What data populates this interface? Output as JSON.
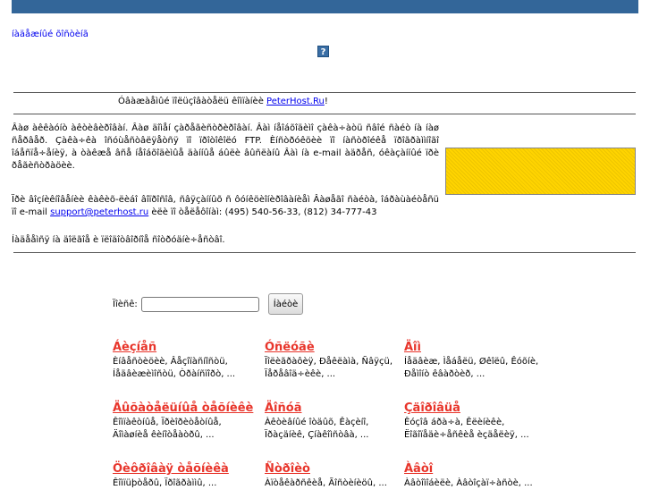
{
  "header": {
    "top_link": "íàäåæíûé õîñòèíã",
    "help_icon_label": "?"
  },
  "welcome": {
    "prefix": "Óâàæàåìûé ïîëüçîâàòåëü êîìïàíèè ",
    "link": "PeterHost.Ru",
    "suffix": "!"
  },
  "paragraphs": {
    "p1": "Âàø àêêàóíò àêòèâèðîâàí. Âàø äîìåí çàðåãèñòðèðîâàí. Âàì íåîáõîäèìî çàêà÷àòü ñâîé ñàéò íà íàø ñåðâåð. Çàêà÷êà îñóùåñòâëÿåòñÿ ïî ïðîòîêîëó FTP. Èíñòðóêöèè ïî íàñòðîéêå ïðîãðàììíîãî îáåñïå÷åíèÿ, à òàêæå âñå íåîáõîäèìûå äàííûå áûëè âûñëàíû Âàì íà e-mail àäðåñ, óêàçàííûé ïðè ðåãèñòðàöèè.",
    "p2_text": "Ïðè âîçíèêíîâåíèè êàêèõ-ëèáî âîïðîñîâ, ñâÿçàííûõ ñ ôóíêöèîíèðîâàíèåì Âàøåãî ñàéòà, îáðàùàéòåñü ïî e-mail ",
    "p2_email": "support@peterhost.ru",
    "p2_tail": " èëè ïî òåëåôîíàì: (495) 540-56-33, (812) 34-777-43",
    "p3": "Íàäååìñÿ íà äîëãîå è ïëîäîòâîðíîå ñîòðóäíè÷åñòâî."
  },
  "search": {
    "label": "Ïîèñê:",
    "value": "",
    "button": "Íàéòè"
  },
  "categories": [
    {
      "title": "Áèçíåñ",
      "sub": "Èíâåñòèöèè, Âåçîïàñíîñòü, Íåäâèæèìîñòü, Òðàíñïîðò, ..."
    },
    {
      "title": "Óñëóãè",
      "sub": "Ïîëèãðàôèÿ, Ðåêëàìà, Ñâÿçü, Ïåðåâîä÷èêè, ..."
    },
    {
      "title": "Äîì",
      "sub": "Íåäâèæ, Ìåáåëü, Øêîëû, Êóõíè, Ðåìîíò êâàðòèð, ..."
    },
    {
      "title": "Äûõàòåëüíûå òåõíèêè",
      "sub": "Êîìïàêòíûå, Ïðèîðèòåòíûå, Äîìàøíèå êèíîòåàòðû, ..."
    },
    {
      "title": "Äîñóã",
      "sub": "Àêòèâíûé îòäûõ, Êàçèíî, Ïðàçäíèê, Çíàêîìñòâà, ..."
    },
    {
      "title": "Çäîðîâüå",
      "sub": "Êóçîâ áðà÷à, Êëèíèêè, Ëîãîïåäè÷åñêèå èçäåëèÿ, ..."
    },
    {
      "title": "Öèôðîâàÿ òåõíèêà",
      "sub": "Êîìïüþòåðû, Ïðîãðàììû, ..."
    },
    {
      "title": "Ñòðîèò",
      "sub": "Àïòåêàðñêèå, Ãîñòèíèöû, ..."
    },
    {
      "title": "Àâòî",
      "sub": "Àâòîìîáèëè, Àâòîçàï÷àñòè, ..."
    }
  ]
}
